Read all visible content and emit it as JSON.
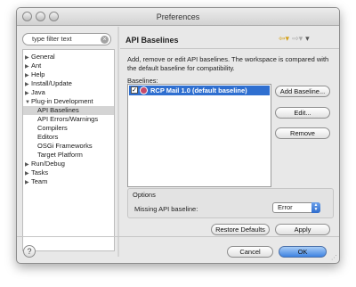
{
  "window": {
    "title": "Preferences"
  },
  "filter": {
    "placeholder": "type filter text"
  },
  "tree": [
    {
      "label": "General",
      "arrow": "▶"
    },
    {
      "label": "Ant",
      "arrow": "▶"
    },
    {
      "label": "Help",
      "arrow": "▶"
    },
    {
      "label": "Install/Update",
      "arrow": "▶"
    },
    {
      "label": "Java",
      "arrow": "▶"
    },
    {
      "label": "Plug-in Development",
      "arrow": "▼"
    },
    {
      "label": "API Baselines",
      "arrow": "",
      "selected": true
    },
    {
      "label": "API Errors/Warnings",
      "arrow": ""
    },
    {
      "label": "Compilers",
      "arrow": ""
    },
    {
      "label": "Editors",
      "arrow": ""
    },
    {
      "label": "OSGi Frameworks",
      "arrow": ""
    },
    {
      "label": "Target Platform",
      "arrow": ""
    },
    {
      "label": "Run/Debug",
      "arrow": "▶"
    },
    {
      "label": "Tasks",
      "arrow": "▶"
    },
    {
      "label": "Team",
      "arrow": "▶"
    }
  ],
  "page": {
    "title": "API Baselines",
    "description": "Add, remove or edit API baselines. The workspace is compared with the default baseline for compatibility.",
    "baselines_label": "Baselines:",
    "baselines": [
      {
        "name": "RCP Mail 1.0  (default baseline)",
        "checked": true
      }
    ],
    "buttons": {
      "add": "Add Baseline...",
      "edit": "Edit...",
      "remove": "Remove"
    },
    "options": {
      "legend": "Options",
      "missing_label": "Missing API baseline:",
      "missing_value": "Error"
    },
    "restore_defaults": "Restore Defaults",
    "apply": "Apply"
  },
  "footer": {
    "help": "?",
    "cancel": "Cancel",
    "ok": "OK"
  },
  "colors": {
    "selection": "#2f6fd0",
    "ok_button": "#3d82e1",
    "baseline_icon": "#c64a6b"
  }
}
